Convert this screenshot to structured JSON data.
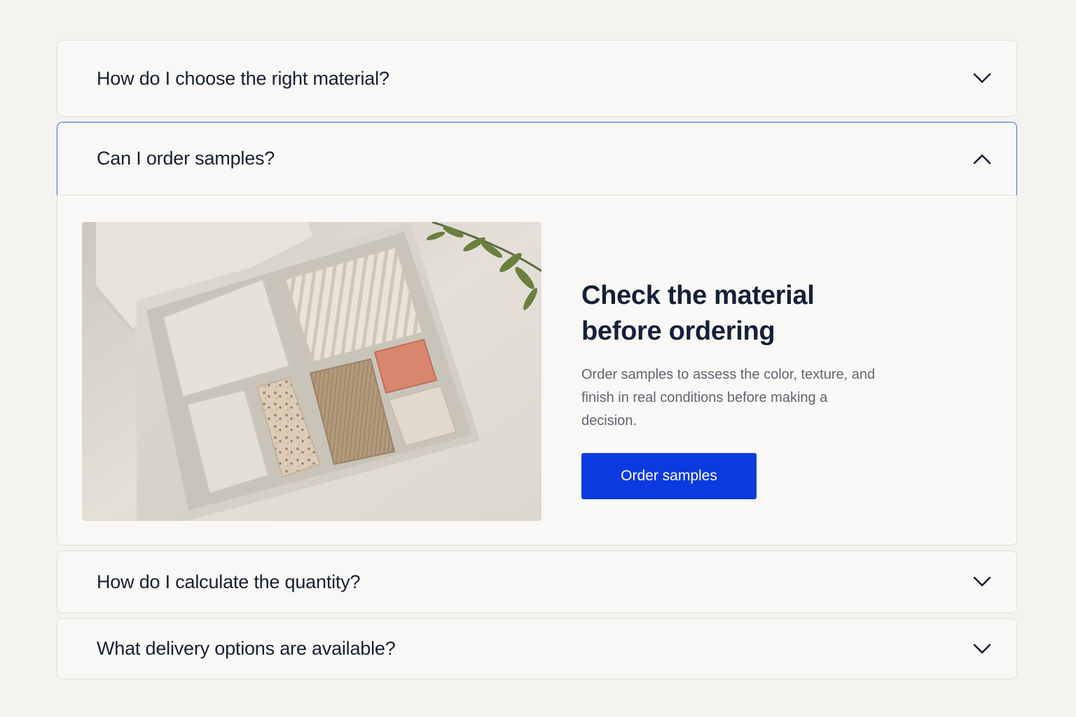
{
  "faq": {
    "items": [
      {
        "question": "How do I choose the right material?",
        "state": "collapsed",
        "icon": "chevron-down-icon"
      },
      {
        "question": "Can I order samples?",
        "state": "expanded",
        "icon": "chevron-up-icon"
      },
      {
        "question": "How do I calculate the quantity?",
        "state": "collapsed",
        "icon": "chevron-down-icon"
      },
      {
        "question": "What delivery options are available?",
        "state": "collapsed",
        "icon": "chevron-down-icon"
      }
    ],
    "expanded_panel": {
      "headline_line1": "Check the material",
      "headline_line2": "before ordering",
      "description": "Order samples to assess the color, texture, and finish in real conditions before making a decision.",
      "button_label": "Order samples"
    }
  },
  "colors": {
    "background": "#f4f3f0",
    "card": "#f9f8f6",
    "active_border": "#3a63d6",
    "button": "#0b3ade",
    "text": "#172033",
    "muted_text": "#5f6570"
  }
}
